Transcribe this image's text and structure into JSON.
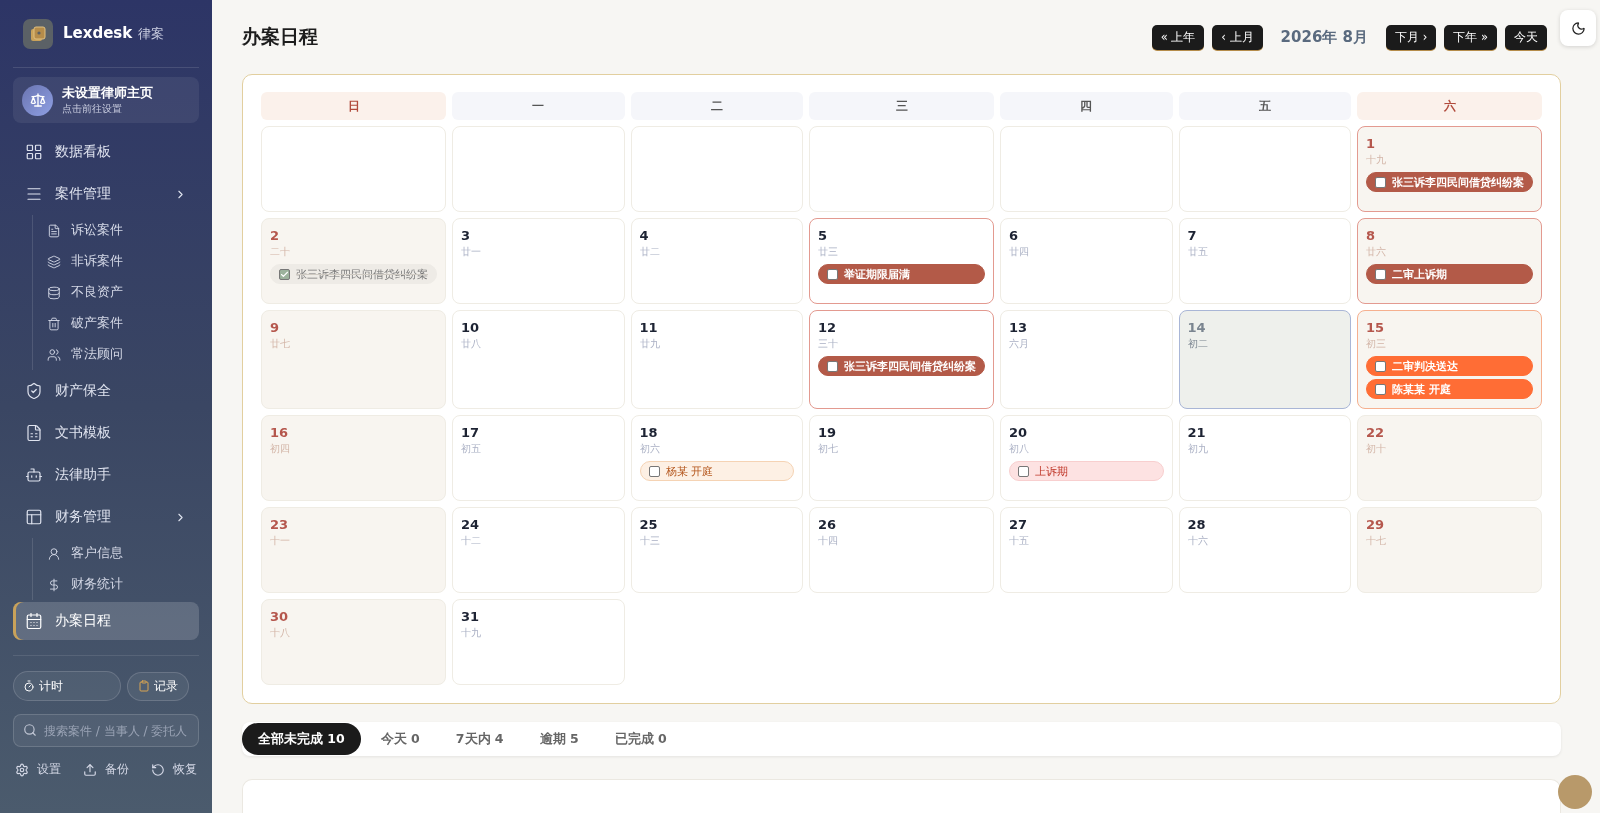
{
  "brand": {
    "name": "Lexdesk",
    "suffix": "律案"
  },
  "profile": {
    "title": "未设置律师主页",
    "subtitle": "点击前往设置"
  },
  "nav": [
    {
      "label": "数据看板",
      "kind": "item",
      "selected": false
    },
    {
      "label": "案件管理",
      "kind": "group",
      "selected": false,
      "expanded": true,
      "children": [
        {
          "label": "诉讼案件",
          "selected": false
        },
        {
          "label": "非诉案件",
          "selected": false
        },
        {
          "label": "不良资产",
          "selected": false
        },
        {
          "label": "破产案件",
          "selected": false
        },
        {
          "label": "常法顾问",
          "selected": false
        }
      ]
    },
    {
      "label": "财产保全",
      "kind": "item",
      "selected": false
    },
    {
      "label": "文书模板",
      "kind": "item",
      "selected": false
    },
    {
      "label": "法律助手",
      "kind": "item",
      "selected": false
    },
    {
      "label": "财务管理",
      "kind": "group",
      "selected": false,
      "expanded": true,
      "children": [
        {
          "label": "客户信息",
          "selected": false
        },
        {
          "label": "财务统计",
          "selected": false
        }
      ]
    },
    {
      "label": "办案日程",
      "kind": "item",
      "selected": true
    }
  ],
  "quick_buttons": [
    "计时",
    "记录"
  ],
  "search": {
    "placeholder": "搜索案件 / 当事人 / 委托人"
  },
  "footer_links": [
    "设置",
    "备份",
    "恢复"
  ],
  "page_title": "办案日程",
  "nav_buttons": {
    "prev": [
      "« 上年",
      "‹ 上月"
    ],
    "month": "2026年 8月",
    "next": [
      "下月 ›",
      "下年 »",
      "今天"
    ]
  },
  "weekdays": [
    {
      "label": "日",
      "weekend": true
    },
    {
      "label": "一",
      "weekend": false
    },
    {
      "label": "二",
      "weekend": false
    },
    {
      "label": "三",
      "weekend": false
    },
    {
      "label": "四",
      "weekend": false
    },
    {
      "label": "五",
      "weekend": false
    },
    {
      "label": "六",
      "weekend": true
    }
  ],
  "weeks": [
    [
      {
        "kind": "blank"
      },
      {
        "kind": "blank"
      },
      {
        "kind": "blank"
      },
      {
        "kind": "blank"
      },
      {
        "kind": "blank"
      },
      {
        "kind": "blank"
      },
      {
        "kind": "day",
        "day": "1",
        "lunar": "十九",
        "weekend": true,
        "today": false,
        "events": [
          {
            "title": "张三诉李四民间借贷纠纷案",
            "kind": "deadline",
            "checked": false
          }
        ]
      }
    ],
    [
      {
        "kind": "day",
        "day": "2",
        "lunar": "二十",
        "weekend": true,
        "today": false,
        "events": [
          {
            "title": "张三诉李四民间借贷纠纷案",
            "kind": "done",
            "checked": true
          }
        ]
      },
      {
        "kind": "day",
        "day": "3",
        "lunar": "廿一",
        "weekend": false,
        "today": false
      },
      {
        "kind": "day",
        "day": "4",
        "lunar": "廿二",
        "weekend": false,
        "today": false
      },
      {
        "kind": "day",
        "day": "5",
        "lunar": "廿三",
        "weekend": false,
        "today": false,
        "events": [
          {
            "title": "举证期限届满",
            "kind": "deadline",
            "checked": false
          }
        ]
      },
      {
        "kind": "day",
        "day": "6",
        "lunar": "廿四",
        "weekend": false,
        "today": false
      },
      {
        "kind": "day",
        "day": "7",
        "lunar": "廿五",
        "weekend": false,
        "today": false
      },
      {
        "kind": "day",
        "day": "8",
        "lunar": "廿六",
        "weekend": true,
        "today": false,
        "events": [
          {
            "title": "二审上诉期",
            "kind": "deadline",
            "checked": false
          }
        ]
      }
    ],
    [
      {
        "kind": "day",
        "day": "9",
        "lunar": "廿七",
        "weekend": true,
        "today": false
      },
      {
        "kind": "day",
        "day": "10",
        "lunar": "廿八",
        "weekend": false,
        "today": false
      },
      {
        "kind": "day",
        "day": "11",
        "lunar": "廿九",
        "weekend": false,
        "today": false
      },
      {
        "kind": "day",
        "day": "12",
        "lunar": "三十",
        "weekend": false,
        "today": false,
        "events": [
          {
            "title": "张三诉李四民间借贷纠纷案",
            "kind": "deadline",
            "checked": false
          }
        ]
      },
      {
        "kind": "day",
        "day": "13",
        "lunar": "六月",
        "weekend": false,
        "today": false
      },
      {
        "kind": "day",
        "day": "14",
        "lunar": "初二",
        "weekend": false,
        "today": true
      },
      {
        "kind": "day",
        "day": "15",
        "lunar": "初三",
        "weekend": true,
        "today": false,
        "events": [
          {
            "title": "二审判决送达",
            "kind": "urgent",
            "checked": false
          },
          {
            "title": "陈某某 开庭",
            "kind": "urgent",
            "checked": false
          }
        ]
      }
    ],
    [
      {
        "kind": "day",
        "day": "16",
        "lunar": "初四",
        "weekend": true,
        "today": false
      },
      {
        "kind": "day",
        "day": "17",
        "lunar": "初五",
        "weekend": false,
        "today": false
      },
      {
        "kind": "day",
        "day": "18",
        "lunar": "初六",
        "weekend": false,
        "today": false,
        "events": [
          {
            "title": "杨某 开庭",
            "kind": "hearing",
            "checked": false
          }
        ]
      },
      {
        "kind": "day",
        "day": "19",
        "lunar": "初七",
        "weekend": false,
        "today": false
      },
      {
        "kind": "day",
        "day": "20",
        "lunar": "初八",
        "weekend": false,
        "today": false,
        "events": [
          {
            "title": "上诉期",
            "kind": "appeal",
            "checked": false
          }
        ]
      },
      {
        "kind": "day",
        "day": "21",
        "lunar": "初九",
        "weekend": false,
        "today": false
      },
      {
        "kind": "day",
        "day": "22",
        "lunar": "初十",
        "weekend": true,
        "today": false
      }
    ],
    [
      {
        "kind": "day",
        "day": "23",
        "lunar": "十一",
        "weekend": true,
        "today": false
      },
      {
        "kind": "day",
        "day": "24",
        "lunar": "十二",
        "weekend": false,
        "today": false
      },
      {
        "kind": "day",
        "day": "25",
        "lunar": "十三",
        "weekend": false,
        "today": false
      },
      {
        "kind": "day",
        "day": "26",
        "lunar": "十四",
        "weekend": false,
        "today": false
      },
      {
        "kind": "day",
        "day": "27",
        "lunar": "十五",
        "weekend": false,
        "today": false
      },
      {
        "kind": "day",
        "day": "28",
        "lunar": "十六",
        "weekend": false,
        "today": false
      },
      {
        "kind": "day",
        "day": "29",
        "lunar": "十七",
        "weekend": true,
        "today": false
      }
    ],
    [
      {
        "kind": "day",
        "day": "30",
        "lunar": "十八",
        "weekend": true,
        "today": false
      },
      {
        "kind": "day",
        "day": "31",
        "lunar": "十九",
        "weekend": false,
        "today": false
      }
    ]
  ],
  "filter_tabs": [
    {
      "label": "全部未完成 10",
      "selected": true
    },
    {
      "label": "今天 0",
      "selected": false
    },
    {
      "label": "7天内 4",
      "selected": false
    },
    {
      "label": "逾期 5",
      "selected": false
    },
    {
      "label": "已完成 0",
      "selected": false
    }
  ]
}
